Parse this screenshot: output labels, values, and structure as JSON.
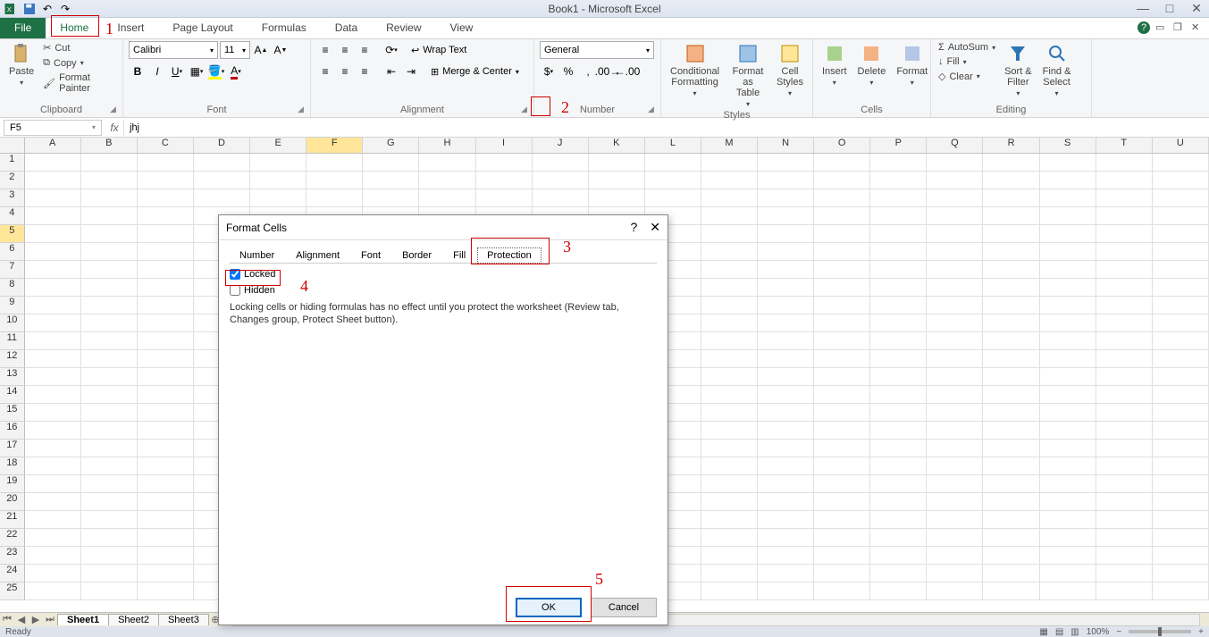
{
  "title": "Book1 - Microsoft Excel",
  "tabs": {
    "file": "File",
    "home": "Home",
    "insert": "Insert",
    "pagelayout": "Page Layout",
    "formulas": "Formulas",
    "data": "Data",
    "review": "Review",
    "view": "View"
  },
  "clipboard": {
    "paste": "Paste",
    "cut": "Cut",
    "copy": "Copy",
    "painter": "Format Painter",
    "label": "Clipboard"
  },
  "font": {
    "name": "Calibri",
    "size": "11",
    "label": "Font"
  },
  "alignment": {
    "wrap": "Wrap Text",
    "merge": "Merge & Center",
    "label": "Alignment"
  },
  "number": {
    "format": "General",
    "label": "Number"
  },
  "styles": {
    "cond": "Conditional\nFormatting",
    "table": "Format\nas Table",
    "cell": "Cell\nStyles",
    "label": "Styles"
  },
  "cells": {
    "insert": "Insert",
    "delete": "Delete",
    "format": "Format",
    "label": "Cells"
  },
  "editing": {
    "autosum": "AutoSum",
    "fill": "Fill",
    "clear": "Clear",
    "sort": "Sort &\nFilter",
    "find": "Find &\nSelect",
    "label": "Editing"
  },
  "namebox": "F5",
  "formula": "jhj",
  "columns": [
    "A",
    "B",
    "C",
    "D",
    "E",
    "F",
    "G",
    "H",
    "I",
    "J",
    "K",
    "L",
    "M",
    "N",
    "O",
    "P",
    "Q",
    "R",
    "S",
    "T",
    "U"
  ],
  "sheets": {
    "s1": "Sheet1",
    "s2": "Sheet2",
    "s3": "Sheet3"
  },
  "status": {
    "ready": "Ready",
    "zoom": "100%"
  },
  "dialog": {
    "title": "Format Cells",
    "tabs": {
      "number": "Number",
      "alignment": "Alignment",
      "font": "Font",
      "border": "Border",
      "fill": "Fill",
      "protection": "Protection"
    },
    "locked": "Locked",
    "hidden": "Hidden",
    "text": "Locking cells or hiding formulas has no effect until you protect the worksheet (Review tab, Changes group, Protect Sheet button).",
    "ok": "OK",
    "cancel": "Cancel"
  },
  "annotations": {
    "n1": "1",
    "n2": "2",
    "n3": "3",
    "n4": "4",
    "n5": "5"
  }
}
